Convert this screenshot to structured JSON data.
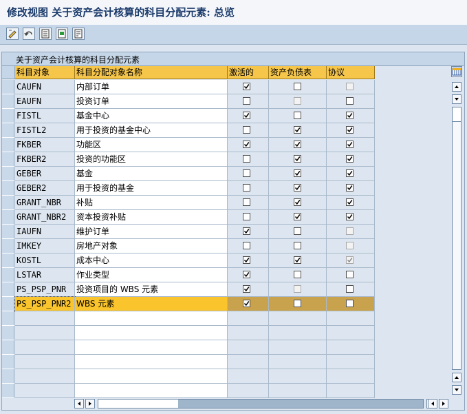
{
  "title": "修改视图 关于资产会计核算的科目分配元素: 总览",
  "toolbar": {
    "icons": [
      "edit-icon",
      "undo-icon",
      "select-all-icon",
      "select-block-icon",
      "deselect-all-icon"
    ]
  },
  "panel": {
    "title": "关于资产会计核算的科目分配元素"
  },
  "columns": [
    "科目对象",
    "科目分配对象名称",
    "激活的",
    "资产负债表",
    "协议"
  ],
  "rows": [
    {
      "code": "CAUFN",
      "name": "内部订单",
      "active": true,
      "balance": false,
      "balance_disabled": false,
      "agreement": false,
      "agreement_disabled": true
    },
    {
      "code": "EAUFN",
      "name": "投资订单",
      "active": false,
      "balance": false,
      "balance_disabled": true,
      "agreement": false,
      "agreement_disabled": false
    },
    {
      "code": "FISTL",
      "name": "基金中心",
      "active": true,
      "balance": false,
      "balance_disabled": false,
      "agreement": true,
      "agreement_disabled": false
    },
    {
      "code": "FISTL2",
      "name": "用于投资的基金中心",
      "active": false,
      "balance": true,
      "balance_disabled": false,
      "agreement": true,
      "agreement_disabled": false
    },
    {
      "code": "FKBER",
      "name": "功能区",
      "active": true,
      "balance": true,
      "balance_disabled": false,
      "agreement": true,
      "agreement_disabled": false
    },
    {
      "code": "FKBER2",
      "name": "投资的功能区",
      "active": false,
      "balance": true,
      "balance_disabled": false,
      "agreement": true,
      "agreement_disabled": false
    },
    {
      "code": "GEBER",
      "name": "基金",
      "active": false,
      "balance": true,
      "balance_disabled": false,
      "agreement": true,
      "agreement_disabled": false
    },
    {
      "code": "GEBER2",
      "name": "用于投资的基金",
      "active": false,
      "balance": true,
      "balance_disabled": false,
      "agreement": true,
      "agreement_disabled": false
    },
    {
      "code": "GRANT_NBR",
      "name": "补贴",
      "active": false,
      "balance": true,
      "balance_disabled": false,
      "agreement": true,
      "agreement_disabled": false
    },
    {
      "code": "GRANT_NBR2",
      "name": "资本投资补贴",
      "active": false,
      "balance": true,
      "balance_disabled": false,
      "agreement": true,
      "agreement_disabled": false
    },
    {
      "code": "IAUFN",
      "name": "维护订单",
      "active": true,
      "balance": false,
      "balance_disabled": false,
      "agreement": false,
      "agreement_disabled": true
    },
    {
      "code": "IMKEY",
      "name": "房地产对象",
      "active": false,
      "balance": false,
      "balance_disabled": false,
      "agreement": false,
      "agreement_disabled": true
    },
    {
      "code": "KOSTL",
      "name": "成本中心",
      "active": true,
      "balance": true,
      "balance_disabled": false,
      "agreement": true,
      "agreement_disabled": true
    },
    {
      "code": "LSTAR",
      "name": "作业类型",
      "active": true,
      "balance": false,
      "balance_disabled": false,
      "agreement": false,
      "agreement_disabled": false
    },
    {
      "code": "PS_PSP_PNR",
      "name": "投资项目的 WBS 元素",
      "active": true,
      "balance": false,
      "balance_disabled": true,
      "agreement": false,
      "agreement_disabled": false
    },
    {
      "code": "PS_PSP_PNR2",
      "name": "WBS 元素",
      "active": true,
      "balance": false,
      "balance_disabled": false,
      "agreement": false,
      "agreement_disabled": false,
      "selected": true
    }
  ],
  "empty_rows": 6
}
